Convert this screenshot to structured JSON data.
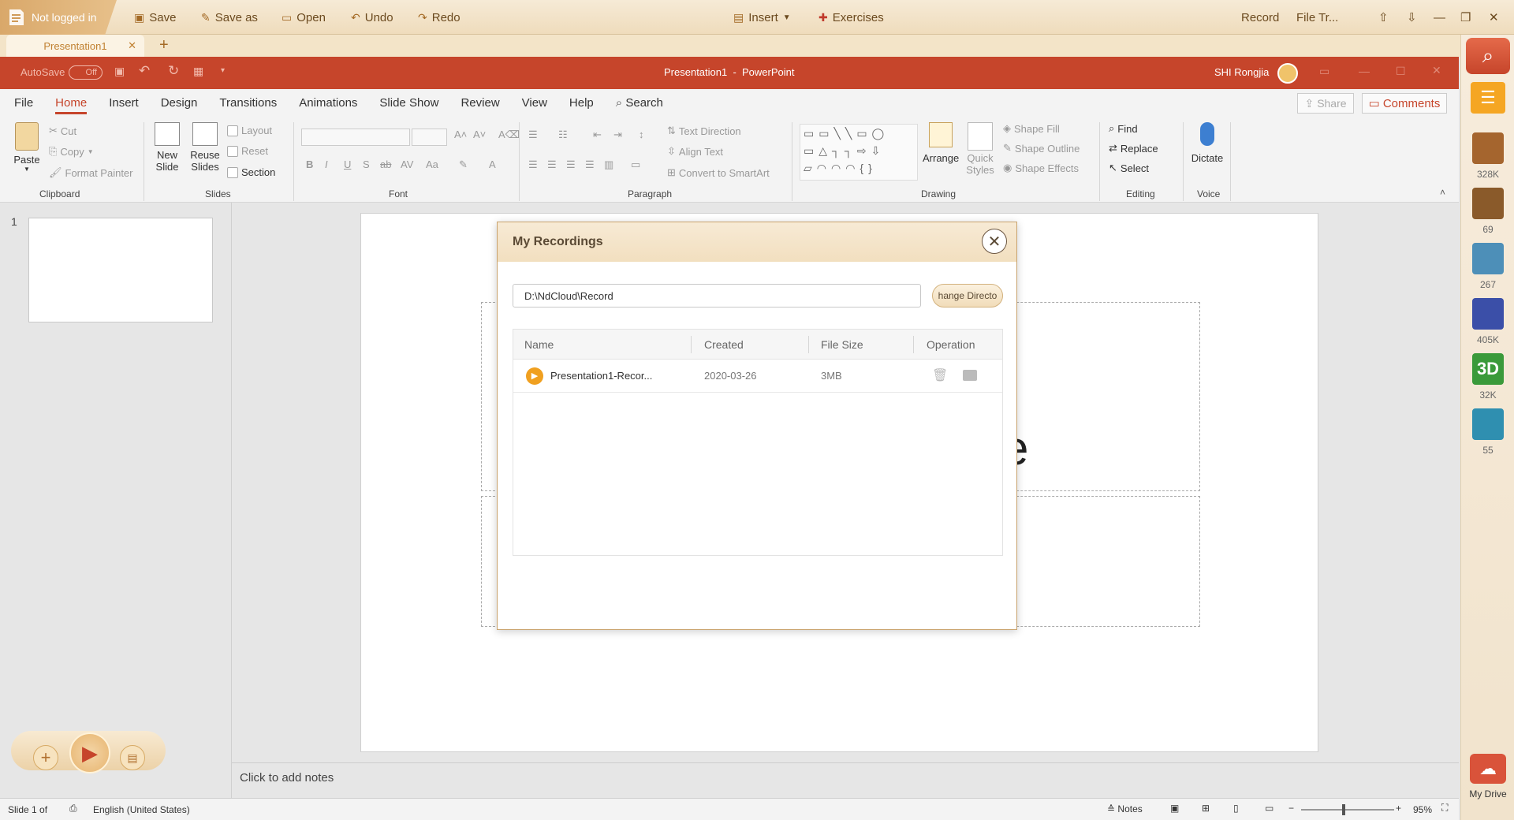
{
  "topbar": {
    "login": "Not logged in",
    "save": "Save",
    "save_as": "Save as",
    "open": "Open",
    "undo": "Undo",
    "redo": "Redo",
    "insert": "Insert",
    "exercises": "Exercises",
    "record": "Record",
    "file_transfer": "File Tr..."
  },
  "doc_tab": {
    "label": "Presentation1"
  },
  "ppt_title": {
    "autosave": "AutoSave",
    "autosave_state": "Off",
    "title": "Presentation1  -  PowerPoint",
    "user": "SHI Rongjia"
  },
  "ribbon_tabs": [
    "File",
    "Home",
    "Insert",
    "Design",
    "Transitions",
    "Animations",
    "Slide Show",
    "Review",
    "View",
    "Help"
  ],
  "ribbon": {
    "search": "Search",
    "share": "Share",
    "comments": "Comments",
    "clipboard": {
      "paste": "Paste",
      "cut": "Cut",
      "copy": "Copy",
      "format_painter": "Format Painter",
      "label": "Clipboard"
    },
    "slides": {
      "new_slide": "New",
      "new_slide2": "Slide",
      "reuse": "Reuse",
      "reuse2": "Slides",
      "layout": "Layout",
      "reset": "Reset",
      "section": "Section",
      "label": "Slides"
    },
    "font": {
      "label": "Font"
    },
    "paragraph": {
      "text_direction": "Text Direction",
      "align_text": "Align Text",
      "convert": "Convert to SmartArt",
      "label": "Paragraph"
    },
    "drawing": {
      "arrange": "Arrange",
      "quick": "Quick",
      "styles": "Styles",
      "shape_fill": "Shape Fill",
      "shape_outline": "Shape Outline",
      "shape_effects": "Shape Effects",
      "label": "Drawing"
    },
    "editing": {
      "find": "Find",
      "replace": "Replace",
      "select": "Select",
      "label": "Editing"
    },
    "voice": {
      "dictate": "Dictate",
      "label": "Voice"
    }
  },
  "slide_pane": {
    "number": "1"
  },
  "slide": {
    "title_fragment": "e"
  },
  "notes": "Click to add notes",
  "status": {
    "slide": "Slide 1 of",
    "language": "English (United States)",
    "notes": "Notes",
    "zoom": "95%"
  },
  "sidebar": {
    "counts": [
      "328K",
      "69",
      "267",
      "405K",
      "32K",
      "55"
    ],
    "three_d": "3D",
    "my_drive": "My Drive"
  },
  "dialog": {
    "title": "My Recordings",
    "path": "D:\\NdCloud\\Record",
    "change_dir": "hange Directo",
    "columns": [
      "Name",
      "Created",
      "File Size",
      "Operation"
    ],
    "rows": [
      {
        "name": "Presentation1-Recor...",
        "created": "2020-03-26",
        "size": "3MB"
      }
    ]
  }
}
